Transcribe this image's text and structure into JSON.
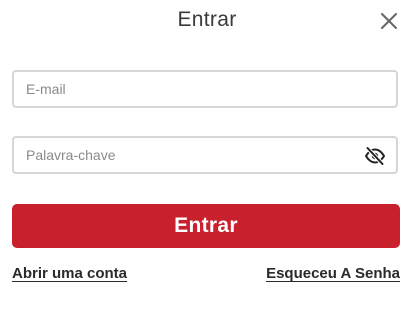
{
  "dialog": {
    "title": "Entrar",
    "close_icon": "close-icon"
  },
  "form": {
    "email": {
      "placeholder": "E-mail",
      "value": ""
    },
    "password": {
      "placeholder": "Palavra-chave",
      "value": "",
      "toggle_icon": "eye-slash-icon"
    },
    "submit_label": "Entrar"
  },
  "links": {
    "register": "Abrir uma conta",
    "forgot": "Esqueceu A Senha"
  },
  "colors": {
    "accent": "#c8202c",
    "border": "#d6d6d6",
    "title": "#3a3a3a"
  }
}
